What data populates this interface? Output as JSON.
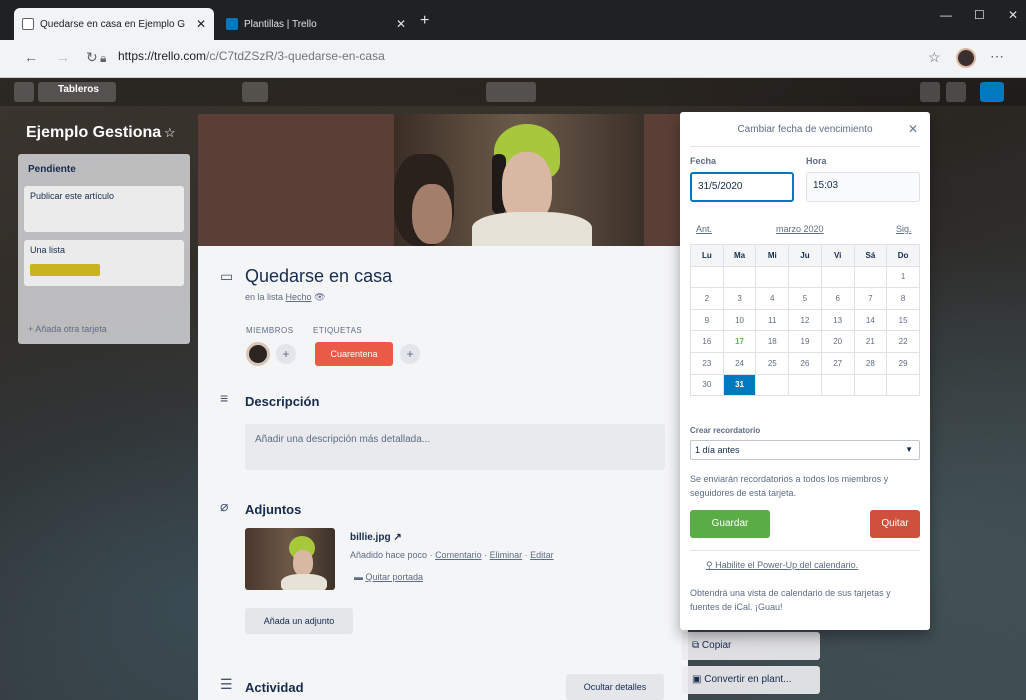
{
  "browser": {
    "tabs": [
      {
        "title": "Quedarse en casa en Ejemplo G",
        "active": true
      },
      {
        "title": "Plantillas | Trello",
        "active": false
      }
    ],
    "url_host": "https://trello.com",
    "url_path": "/c/C7tdZSzR/3-quedarse-en-casa"
  },
  "board": {
    "header_left": "Tableros",
    "title": "Ejemplo Gestiona",
    "list": {
      "title": "Pendiente",
      "cards": [
        {
          "text": "Publicar este artículo"
        },
        {
          "text": "Una lista"
        }
      ],
      "add_card": "+ Añada otra tarjeta"
    }
  },
  "card": {
    "title": "Quedarse en casa",
    "in_list_prefix": "en la lista",
    "list_name": "Hecho",
    "members_label": "MIEMBROS",
    "labels_label": "ETIQUETAS",
    "label_tag": "Cuarentena",
    "description_title": "Descripción",
    "description_placeholder": "Añadir una descripción más detallada...",
    "attachments_title": "Adjuntos",
    "attachment": {
      "name": "billie.jpg",
      "added": "Añadido hace poco",
      "comment": "Comentario",
      "delete": "Eliminar",
      "edit": "Editar",
      "remove_cover": "Quitar portada"
    },
    "add_attachment": "Añada un adjunto",
    "activity_title": "Actividad",
    "hide_details": "Ocultar detalles",
    "side_buttons": {
      "copy": "Copiar",
      "convert": "Convertir en plant..."
    }
  },
  "date_popover": {
    "title": "Cambiar fecha de vencimiento",
    "date_label": "Fecha",
    "date_value": "31/5/2020",
    "time_label": "Hora",
    "time_value": "15:03",
    "prev": "Ant.",
    "month": "marzo",
    "year": "2020",
    "next": "Sig.",
    "weekdays": [
      "Lu",
      "Ma",
      "Mi",
      "Ju",
      "Vi",
      "Sá",
      "Do"
    ],
    "weeks": [
      [
        "",
        "",
        "",
        "",
        "",
        "",
        "1"
      ],
      [
        "2",
        "3",
        "4",
        "5",
        "6",
        "7",
        "8"
      ],
      [
        "9",
        "10",
        "11",
        "12",
        "13",
        "14",
        "15"
      ],
      [
        "16",
        "17",
        "18",
        "19",
        "20",
        "21",
        "22"
      ],
      [
        "23",
        "24",
        "25",
        "26",
        "27",
        "28",
        "29"
      ],
      [
        "30",
        "31",
        "",
        "",
        "",
        "",
        ""
      ]
    ],
    "today": "17",
    "selected": "31",
    "reminder_label": "Crear recordatorio",
    "reminder_value": "1 día antes",
    "reminder_note": "Se enviarán recordatorios a todos los miembros y seguidores de esta tarjeta.",
    "save": "Guardar",
    "remove": "Quitar",
    "powerup_link": "Habilite el Power-Up del calendario.",
    "powerup_note": "Obtendrá una vista de calendario de sus tarjetas y fuentes de iCal. ¡Guau!"
  },
  "colors": {
    "save_green": "#5aac44",
    "remove_red": "#cf513d",
    "label_red": "#eb5a46",
    "selected_blue": "#0079bf",
    "today_green": "#61bd4f"
  }
}
